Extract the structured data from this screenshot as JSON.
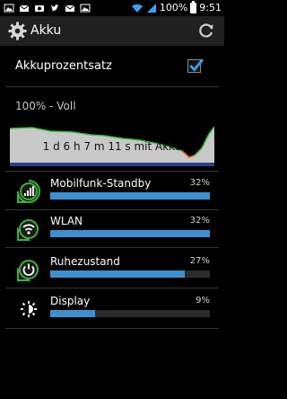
{
  "status_bar": {
    "battery_text": "100%",
    "time": "9:51",
    "icons": [
      "image-icon",
      "mail-icon",
      "camera-icon",
      "twitter-icon",
      "mail-icon",
      "image-icon",
      "wifi-icon",
      "signal-icon",
      "battery-icon"
    ]
  },
  "action_bar": {
    "title": "Akku",
    "gear_icon": "gear-icon",
    "refresh_icon": "refresh-icon"
  },
  "settings": {
    "battery_percent_label": "Akkuprozentsatz",
    "battery_percent_checked": true
  },
  "charge_status": "100% - Voll",
  "graph": {
    "label": "1 d 6 h 7 m 11 s mit Akku",
    "colors": {
      "fill": "#c9c9c9",
      "line": "#3fbf3f",
      "low_line": "#e06a2a",
      "base": "#2d3f8a"
    }
  },
  "usage": [
    {
      "label": "Mobilfunk-Standby",
      "percent_text": "32%",
      "fraction": 0.32,
      "icon": "signal-icon"
    },
    {
      "label": "WLAN",
      "percent_text": "32%",
      "fraction": 0.32,
      "icon": "wifi-icon"
    },
    {
      "label": "Ruhezustand",
      "percent_text": "27%",
      "fraction": 0.27,
      "icon": "power-icon"
    },
    {
      "label": "Display",
      "percent_text": "9%",
      "fraction": 0.09,
      "icon": "display-brightness-icon"
    }
  ],
  "colors": {
    "accent": "#3f8fce",
    "background": "#000000",
    "action_bar": "#202020"
  }
}
